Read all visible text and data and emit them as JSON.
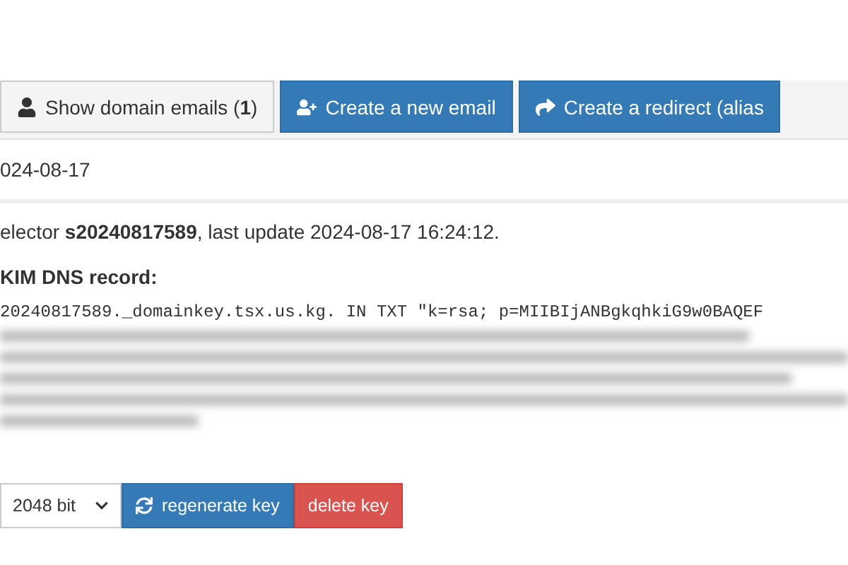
{
  "toolbar": {
    "buttons": [
      {
        "label": "Show domain emails (",
        "count": "1",
        "close": ")",
        "kind": "default"
      },
      {
        "label": "Create a new email",
        "kind": "primary"
      },
      {
        "label": "Create a redirect (alias",
        "kind": "primary"
      }
    ]
  },
  "panel": {
    "heading": "024-08-17",
    "selector_line": "elector **s20240817589**, last update 2024-08-17 16:24:12.",
    "record_title": "KIM DNS record:",
    "record_line": "20240817589._domainkey.tsx.us.kg. IN TXT \"k=rsa; p=MIIBIjANBgkqhkiG9w0BAQEF",
    "key_size": "2048 bit",
    "actions": [
      {
        "label": "regenerate key",
        "kind": "primary"
      },
      {
        "label": "delete key",
        "kind": "danger"
      }
    ]
  }
}
